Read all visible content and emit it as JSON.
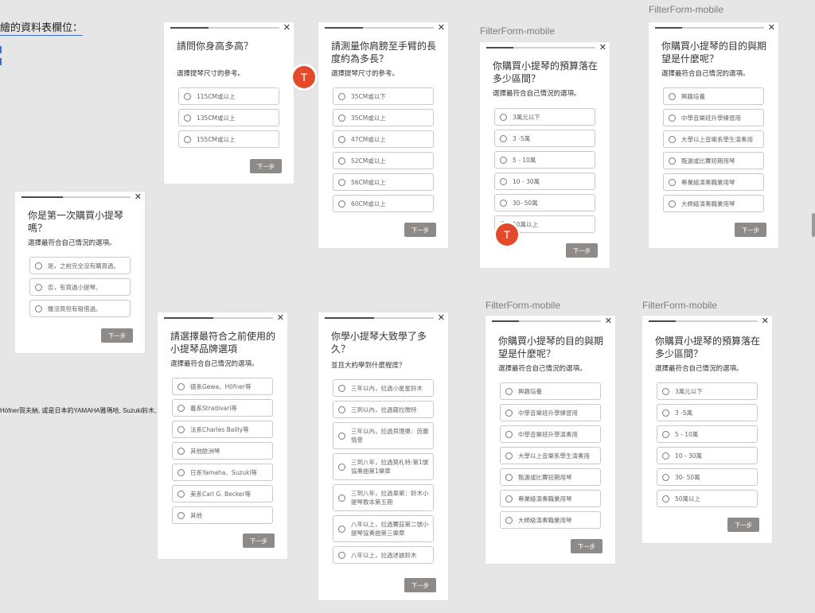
{
  "side": {
    "title": "繪的資料表欄位：",
    "note": "Höfner賀夫納, 或是日本的YAMAHA雅瑪哈, Suzuki鈴木,"
  },
  "frame_label": "FilterForm-mobile",
  "next_label": "下一步",
  "avatar_letter": "T",
  "colors": {
    "avatar": "#e24a2a",
    "next_button": "#8e8a88",
    "link": "#3a6fd8"
  },
  "cards": {
    "height": {
      "title": "請問你身高多高？",
      "sub": "選擇提琴尺寸的參考。",
      "progress": 0.35,
      "options": [
        "115CM或以上",
        "135CM或以上",
        "155CM或以上"
      ]
    },
    "arm": {
      "title": "請測量你肩膀至手臂的長度約為多長？",
      "sub": "選擇提琴尺寸的參考。",
      "progress": 0.35,
      "options": [
        "35CM或以下",
        "35CM或以上",
        "47CM或以上",
        "52CM或以上",
        "56CM或以上",
        "60CM或以上"
      ]
    },
    "budget1": {
      "title": "你購買小提琴的預算落在多少區間？",
      "sub": "選擇最符合自己情況的選項。",
      "progress": 0.25,
      "options": [
        "3萬元以下",
        "3 -5萬",
        "5 - 10萬",
        "10 - 30萬",
        "30- 50萬",
        "50萬以上"
      ]
    },
    "purpose1": {
      "title": "你購買小提琴的目的與期望是什麼呢？",
      "sub": "選擇最符合自己情況的選項。",
      "progress": 0.25,
      "options": [
        "興趣培養",
        "中學音樂班升學練習用",
        "大學以上音樂系學生演奏用",
        "甄選或比賽短期用琴",
        "專業級演奏職業用琴",
        "大師級演奏職業用琴"
      ]
    },
    "first": {
      "title": "你是第一次購買小提琴嗎？",
      "sub": "選擇最符合自己情況的選項。",
      "progress": 0.38,
      "options": [
        "是，之前完全沒有購買過。",
        "否，有買過小提琴。",
        "雖沒買但有租借過。"
      ]
    },
    "brand": {
      "title": "請選擇最符合之前使用的小提琴品牌選項",
      "sub": "選擇最符合自己情況的選項。",
      "progress": 0.45,
      "options": [
        "德系Gewa、Höfner等",
        "義系Stradivari等",
        "法系Charles Bailly等",
        "其他歐洲琴",
        "日系Yamaha、Suzuki等",
        "美系Carl G. Becker等",
        "其他"
      ]
    },
    "years": {
      "title": "你學小提琴大致學了多久？",
      "sub": "並且大約學到什麼程度？",
      "progress": 0.45,
      "options": [
        "三年以內，拉過小星星鈴木",
        "三到以內，拉過薩拉微特",
        "三年以內，拉過貝理奧：芭蕾情景",
        "三到八年，拉過莫札特:第1號協奏曲第1樂章",
        "三到八年，拉過韋第：鈴木小提琴教本第五冊",
        "八年以上，拉過賽茲第二號小提琴協奏曲第三樂章",
        "八年以上，拉過述據鈴木"
      ]
    },
    "purpose2": {
      "title": "你購買小提琴的目的與期望是什麼呢？",
      "sub": "選擇最符合自己情況的選項。",
      "progress": 0.25,
      "options": [
        "興趣培養",
        "中學音樂班升學練習用",
        "中學音樂班升學演奏用",
        "大學以上音樂系學生演奏用",
        "甄選或比賽短期用琴",
        "專業級演奏職業用琴",
        "大師級演奏職業用琴"
      ]
    },
    "budget2": {
      "title": "你購買小提琴的預算落在多少區間？",
      "sub": "選擇最符合自己情況的選項。",
      "progress": 0.25,
      "options": [
        "3萬元以下",
        "3 -5萬",
        "5 - 10萬",
        "10 - 30萬",
        "30- 50萬",
        "50萬以上"
      ]
    }
  }
}
